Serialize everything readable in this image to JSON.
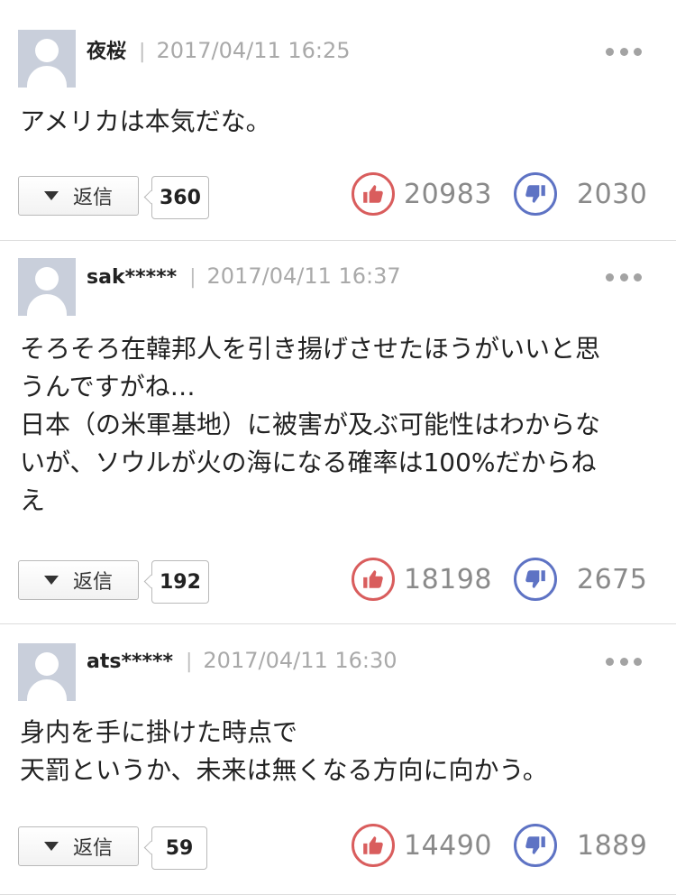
{
  "comments": [
    {
      "name": "夜桜",
      "separator": "|",
      "date": "2017/04/11 16:25",
      "lines": [
        "アメリカは本気だな。"
      ],
      "reply_label": "返信",
      "reply_count": "360",
      "likes": "20983",
      "dislikes": "2030"
    },
    {
      "name": "sak*****",
      "separator": "|",
      "date": "2017/04/11 16:37",
      "lines": [
        "そろそろ在韓邦人を引き揚げさせたほうがいいと思",
        "うんですがね…",
        "日本（の米軍基地）に被害が及ぶ可能性はわからな",
        "いが、ソウルが火の海になる確率は100%だからね",
        "え"
      ],
      "reply_label": "返信",
      "reply_count": "192",
      "likes": "18198",
      "dislikes": "2675"
    },
    {
      "name": "ats*****",
      "separator": "|",
      "date": "2017/04/11 16:30",
      "lines": [
        "身内を手に掛けた時点で",
        "天罰というか、未来は無くなる方向に向かう。"
      ],
      "reply_label": "返信",
      "reply_count": "59",
      "likes": "14490",
      "dislikes": "1889"
    }
  ],
  "icons": {
    "like": "thumbs-up-icon",
    "dislike": "thumbs-down-icon",
    "more": "more-icon",
    "avatar": "default-avatar"
  },
  "colors": {
    "like": "#d95d5d",
    "dislike": "#5e73c4",
    "count_text": "#8a8a8a",
    "date_text": "#a9a9a9"
  }
}
